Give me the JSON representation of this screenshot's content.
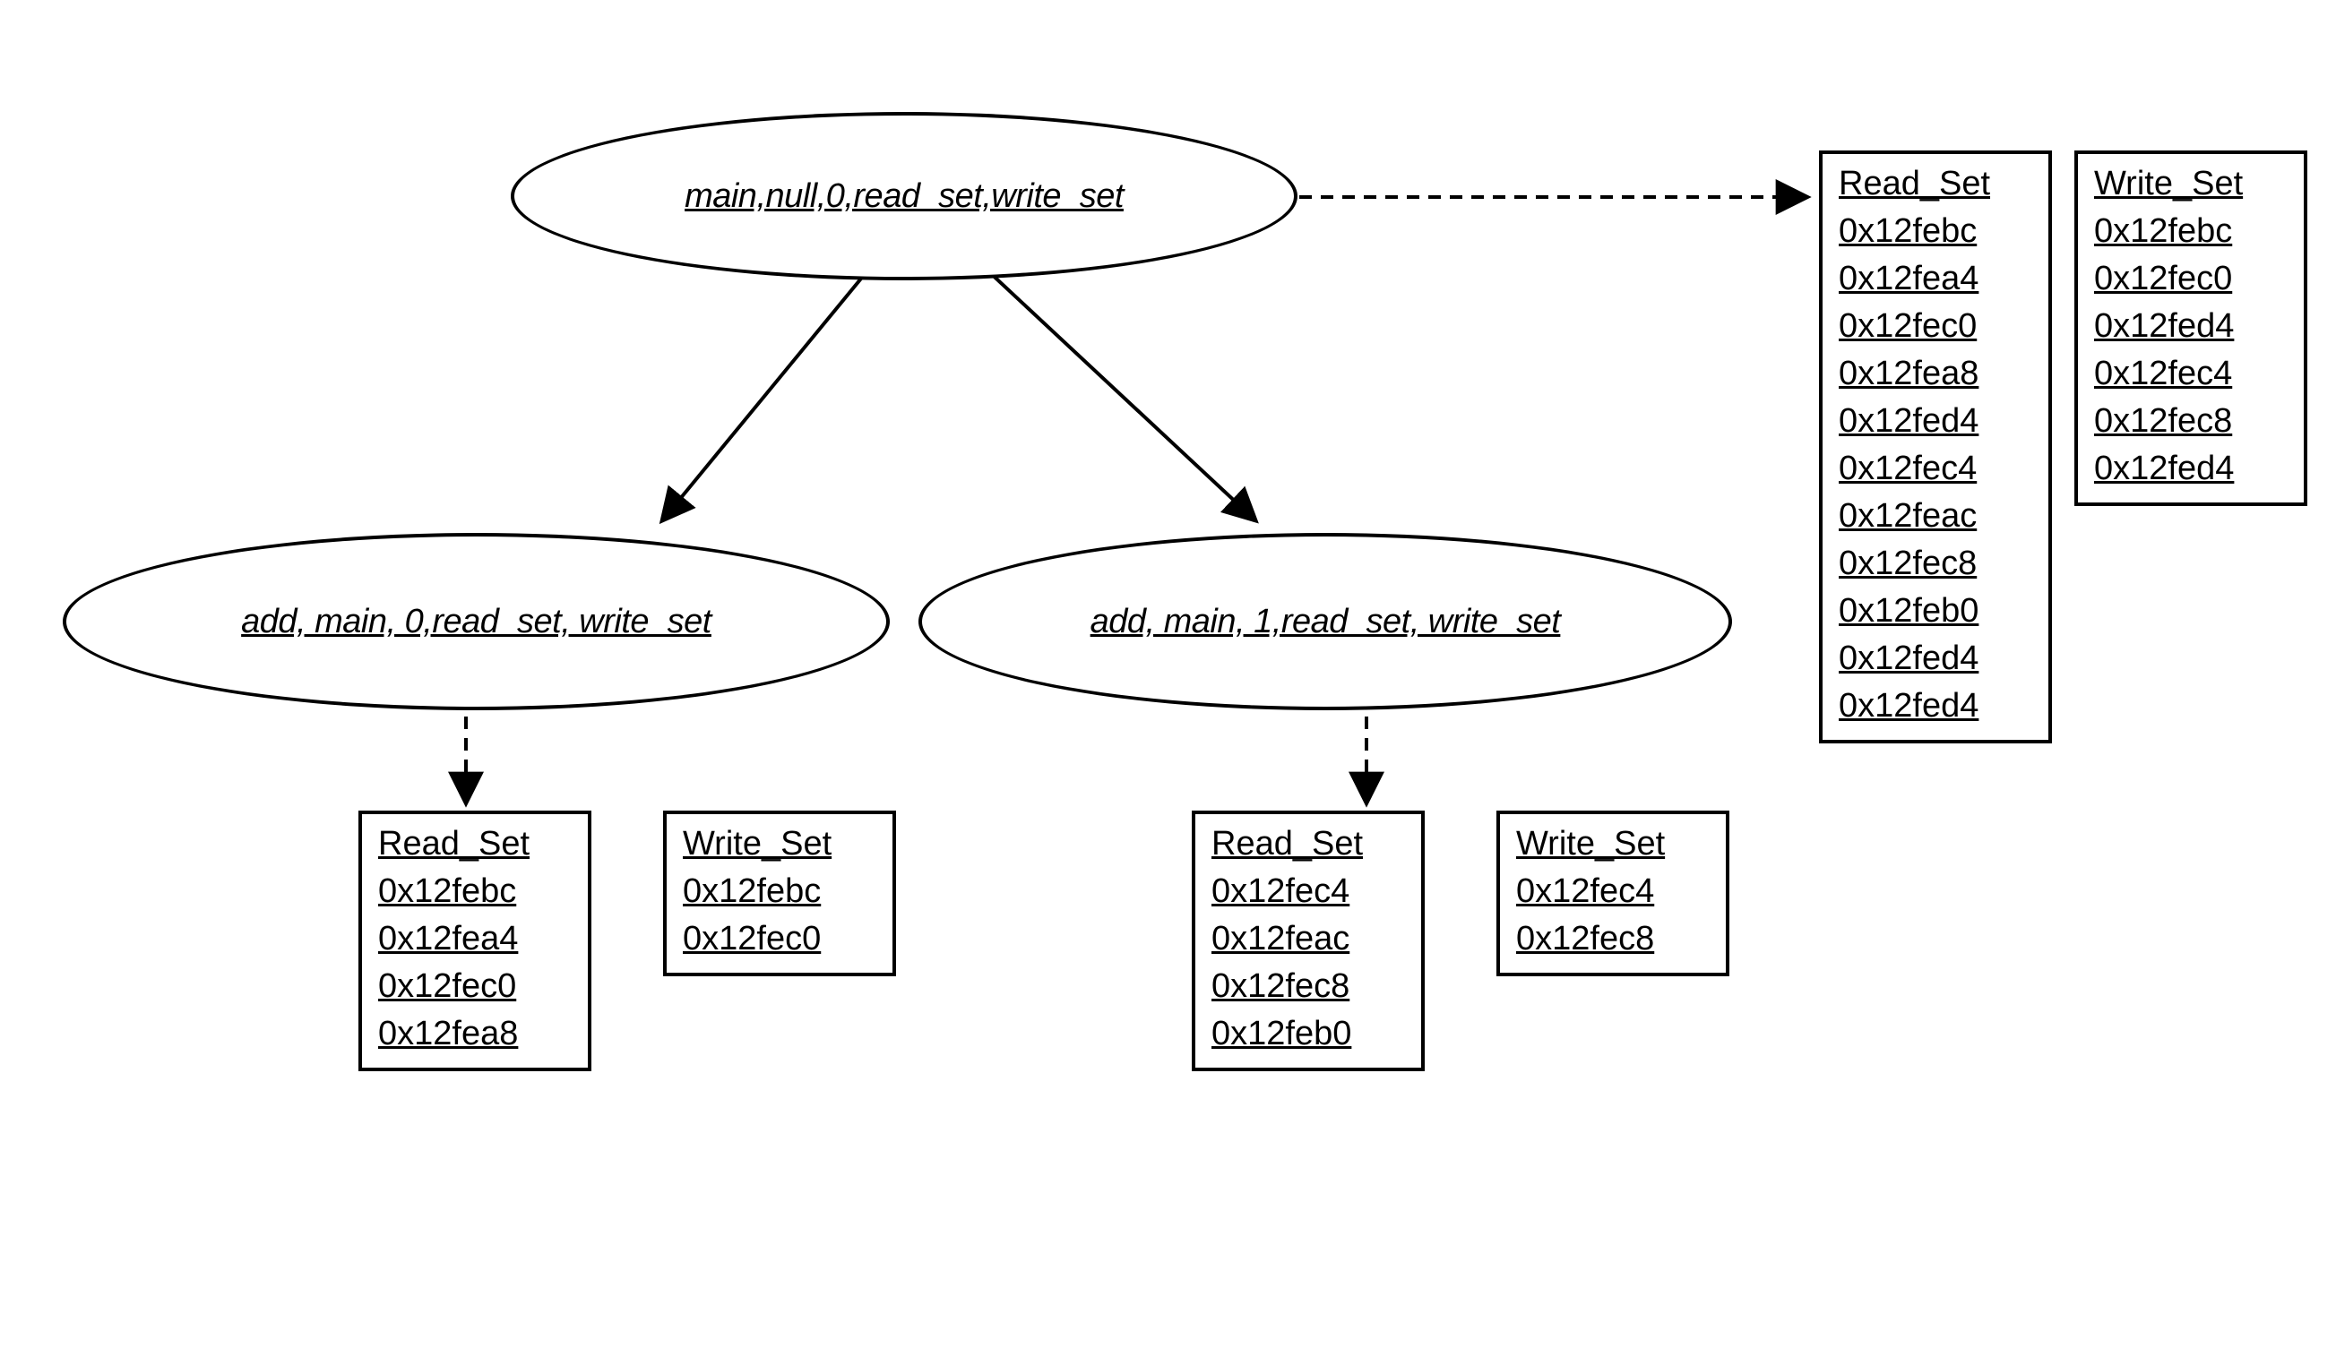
{
  "nodes": {
    "root": {
      "label": "main,null,0,read_set,write_set"
    },
    "childLeft": {
      "label": "add, main, 0,read_set, write_set"
    },
    "childRight": {
      "label": "add, main, 1,read_set, write_set"
    }
  },
  "sets": {
    "leftRead": {
      "title": "Read_Set",
      "addrs": [
        "0x12febc",
        "0x12fea4",
        "0x12fec0",
        "0x12fea8"
      ]
    },
    "leftWrite": {
      "title": "Write_Set",
      "addrs": [
        "0x12febc",
        "0x12fec0"
      ]
    },
    "rightRead": {
      "title": "Read_Set",
      "addrs": [
        "0x12fec4",
        "0x12feac",
        "0x12fec8",
        "0x12feb0"
      ]
    },
    "rightWrite": {
      "title": "Write_Set",
      "addrs": [
        "0x12fec4",
        "0x12fec8"
      ]
    },
    "topRead": {
      "title": "Read_Set",
      "addrs": [
        "0x12febc",
        "0x12fea4",
        "0x12fec0",
        "0x12fea8",
        "0x12fed4",
        "0x12fec4",
        "0x12feac",
        "0x12fec8",
        "0x12feb0",
        "0x12fed4",
        "0x12fed4"
      ]
    },
    "topWrite": {
      "title": "Write_Set",
      "addrs": [
        "0x12febc",
        "0x12fec0",
        "0x12fed4",
        "0x12fec4",
        "0x12fec8",
        "0x12fed4"
      ]
    }
  }
}
